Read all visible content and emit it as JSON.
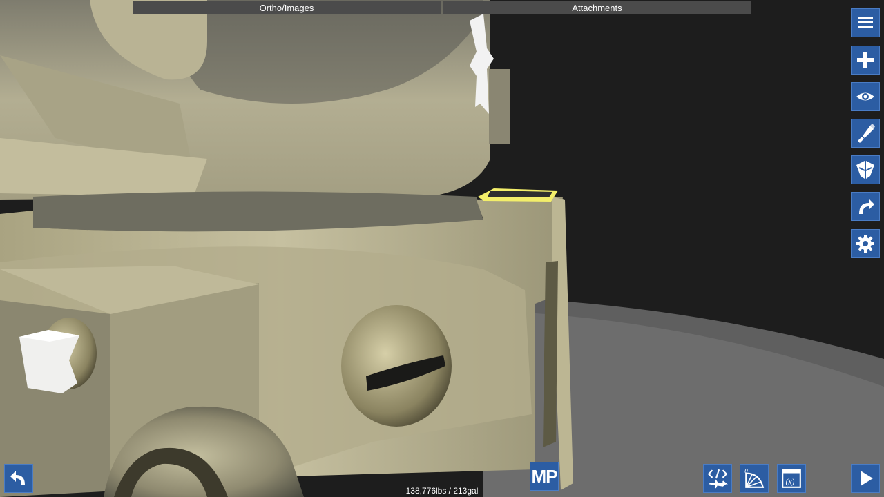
{
  "top_tabs": {
    "ortho_images": "Ortho/Images",
    "attachments": "Attachments"
  },
  "right_toolbar": [
    {
      "icon": "menu-icon"
    },
    {
      "icon": "add-part-icon"
    },
    {
      "icon": "view-icon"
    },
    {
      "icon": "paint-icon"
    },
    {
      "icon": "symmetry-icon"
    },
    {
      "icon": "redo-icon"
    },
    {
      "icon": "settings-icon"
    }
  ],
  "bottom_bar": {
    "undo_icon": "undo-icon",
    "mp_label": "MP",
    "mass_readout": "138,776lbs / 213gal",
    "xml_icon": "xml-editor-icon",
    "rotation_icon": "rotation-gizmo-icon",
    "variables_icon": "variables-icon",
    "play_icon": "play-icon"
  },
  "colors": {
    "tool_blue": "#2c5da3",
    "tab_gray": "#4b4b4b",
    "hull_khaki": "#bab494",
    "selection_yellow": "#f3ee6a"
  }
}
